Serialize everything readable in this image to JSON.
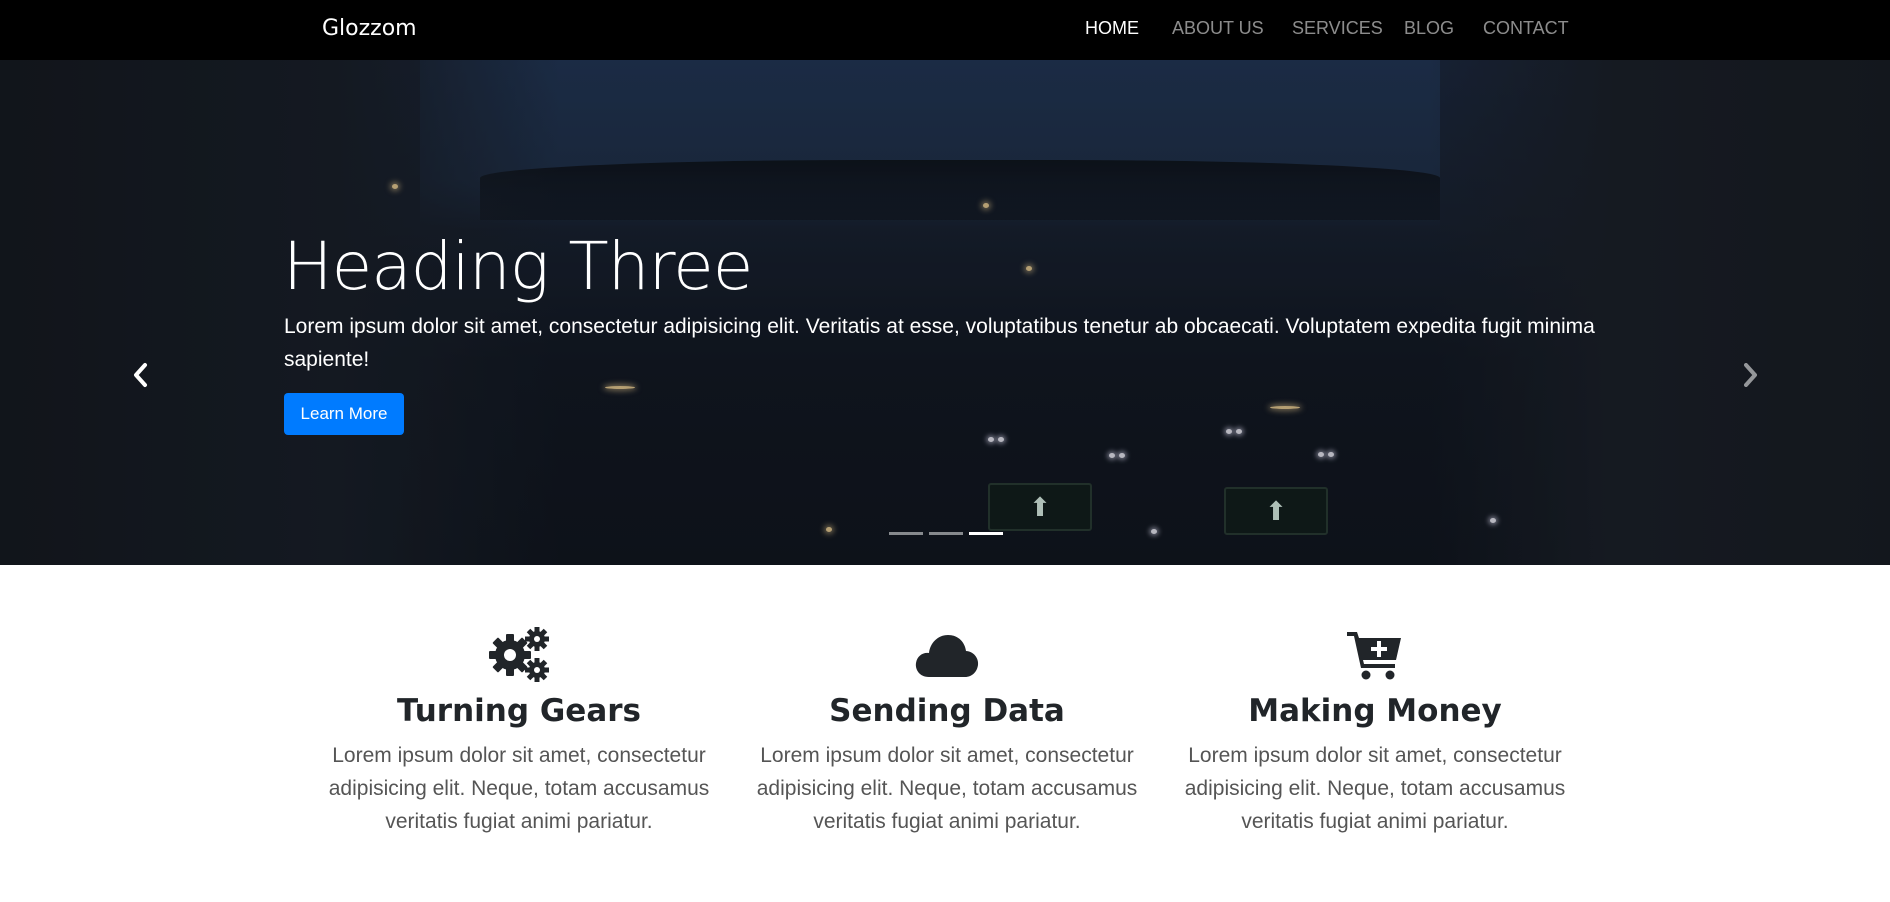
{
  "navbar": {
    "brand": "Glozzom",
    "items": [
      {
        "label": "HOME",
        "active": true
      },
      {
        "label": "ABOUT US",
        "active": false
      },
      {
        "label": "SERVICES",
        "active": false
      },
      {
        "label": "BLOG",
        "active": false
      },
      {
        "label": "CONTACT",
        "active": false
      }
    ]
  },
  "hero": {
    "title": "Heading Three",
    "text": "Lorem ipsum dolor sit amet, consectetur adipisicing elit. Veritatis at esse, voluptatibus tenetur ab obcaecati. Voluptatem expedita fugit minima sapiente!",
    "button_label": "Learn More",
    "prev_icon": "chevron-left-icon",
    "next_icon": "chevron-right-icon",
    "slide_count": 3,
    "active_slide": 3,
    "accent": "#007bff"
  },
  "features": [
    {
      "icon": "cogs-icon",
      "title": "Turning Gears",
      "text": "Lorem ipsum dolor sit amet, consectetur adipisicing elit. Neque, totam accusamus veritatis fugiat animi pariatur."
    },
    {
      "icon": "cloud-icon",
      "title": "Sending Data",
      "text": "Lorem ipsum dolor sit amet, consectetur adipisicing elit. Neque, totam accusamus veritatis fugiat animi pariatur."
    },
    {
      "icon": "cart-plus-icon",
      "title": "Making Money",
      "text": "Lorem ipsum dolor sit amet, consectetur adipisicing elit. Neque, totam accusamus veritatis fugiat animi pariatur."
    }
  ]
}
